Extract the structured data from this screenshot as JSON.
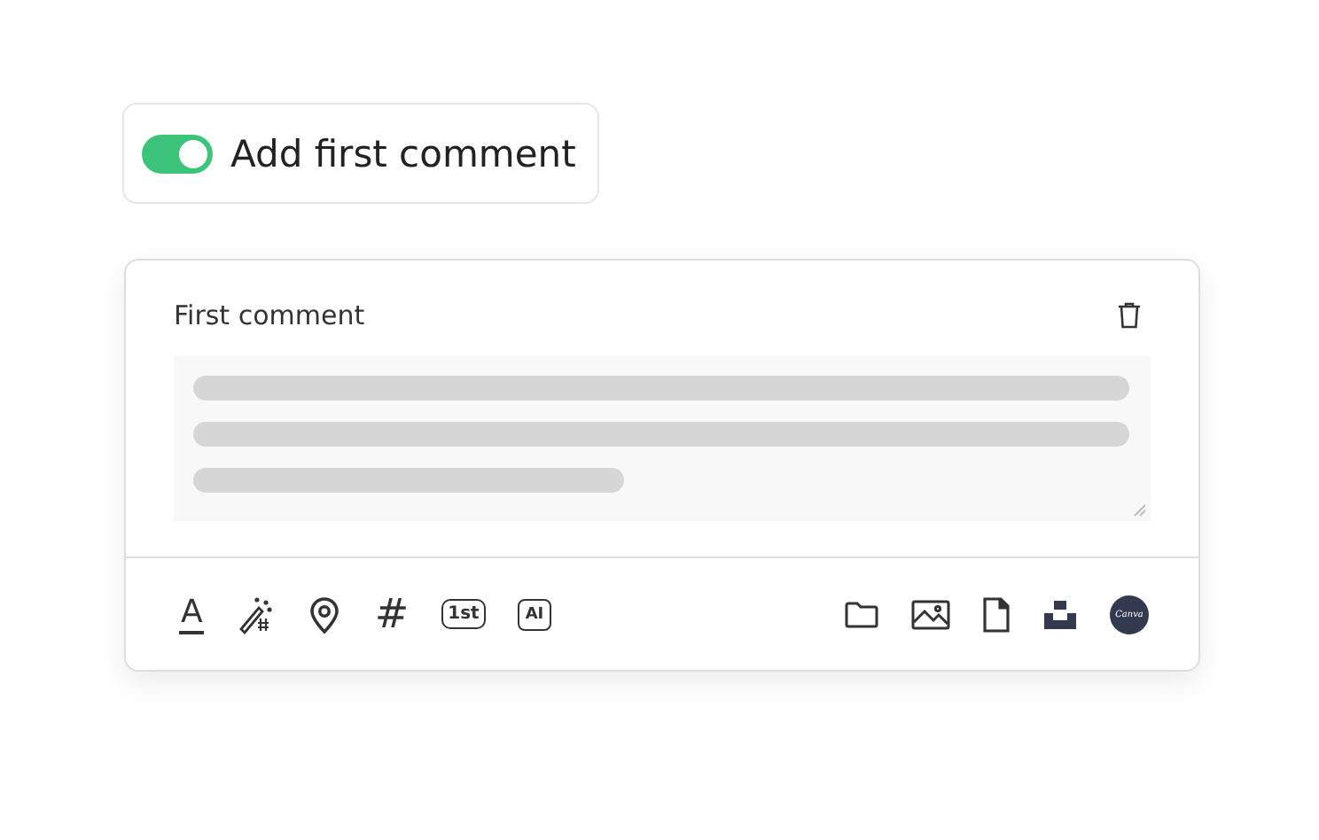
{
  "toggle": {
    "label": "Add first comment",
    "on": true
  },
  "comment": {
    "title": "First comment"
  },
  "toolbar_left": [
    {
      "kind": "text-format",
      "text": "A"
    },
    {
      "kind": "magic"
    },
    {
      "kind": "location"
    },
    {
      "kind": "hashtag",
      "text": "#"
    },
    {
      "kind": "first-badge",
      "text": "1st"
    },
    {
      "kind": "ai-badge",
      "text": "AI"
    }
  ],
  "toolbar_right": [
    {
      "kind": "folder"
    },
    {
      "kind": "image"
    },
    {
      "kind": "file"
    },
    {
      "kind": "stack"
    },
    {
      "kind": "logo",
      "text": "Canva"
    }
  ]
}
